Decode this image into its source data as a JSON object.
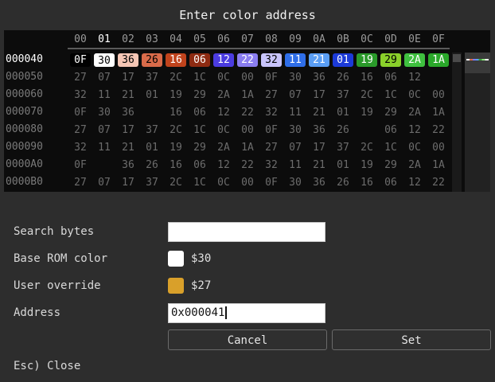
{
  "dialog": {
    "title": "Enter color address"
  },
  "hex": {
    "columns": [
      "00",
      "01",
      "02",
      "03",
      "04",
      "05",
      "06",
      "07",
      "08",
      "09",
      "0A",
      "0B",
      "0C",
      "0D",
      "0E",
      "0F"
    ],
    "selected_column": 1,
    "rows": [
      {
        "addr": "000040",
        "active": true,
        "bytes": [
          "0F",
          "30",
          "36",
          "26",
          "16",
          "06",
          "12",
          "22",
          "32",
          "11",
          "21",
          "01",
          "19",
          "29",
          "2A",
          "1A"
        ]
      },
      {
        "addr": "000050",
        "bytes": [
          "27",
          "07",
          "17",
          "37",
          "2C",
          "1C",
          "0C",
          "00",
          "0F",
          "30",
          "36",
          "26",
          "16",
          "06",
          "12",
          ""
        ]
      },
      {
        "addr": "000060",
        "bytes": [
          "32",
          "11",
          "21",
          "01",
          "19",
          "29",
          "2A",
          "1A",
          "27",
          "07",
          "17",
          "37",
          "2C",
          "1C",
          "0C",
          "00"
        ]
      },
      {
        "addr": "000070",
        "bytes": [
          "0F",
          "30",
          "36",
          "",
          "16",
          "06",
          "12",
          "22",
          "32",
          "11",
          "21",
          "01",
          "19",
          "29",
          "2A",
          "1A"
        ]
      },
      {
        "addr": "000080",
        "bytes": [
          "27",
          "07",
          "17",
          "37",
          "2C",
          "1C",
          "0C",
          "00",
          "0F",
          "30",
          "36",
          "26",
          "",
          "06",
          "12",
          "22"
        ]
      },
      {
        "addr": "000090",
        "bytes": [
          "32",
          "11",
          "21",
          "01",
          "19",
          "29",
          "2A",
          "1A",
          "27",
          "07",
          "17",
          "37",
          "2C",
          "1C",
          "0C",
          "00"
        ]
      },
      {
        "addr": "0000A0",
        "bytes": [
          "0F",
          "",
          "36",
          "26",
          "16",
          "06",
          "12",
          "22",
          "32",
          "11",
          "21",
          "01",
          "19",
          "29",
          "2A",
          "1A"
        ]
      },
      {
        "addr": "0000B0",
        "bytes": [
          "27",
          "07",
          "17",
          "37",
          "2C",
          "1C",
          "0C",
          "00",
          "0F",
          "30",
          "36",
          "26",
          "16",
          "06",
          "12",
          "22"
        ]
      }
    ],
    "active_colors": [
      "#000000",
      "#ffffff",
      "#f5c6b5",
      "#d96b4a",
      "#c0431c",
      "#8e2b12",
      "#4b3ce0",
      "#8a7df0",
      "#c8c4fb",
      "#2f6ee8",
      "#5a9ef5",
      "#1c3ad8",
      "#2a9a2a",
      "#8ad02a",
      "#3fc03f",
      "#2aa82a"
    ],
    "active_text_colors": [
      "#ffffff",
      "#000000",
      "#000000",
      "#000000",
      "#ffffff",
      "#ffffff",
      "#ffffff",
      "#ffffff",
      "#000000",
      "#ffffff",
      "#ffffff",
      "#ffffff",
      "#ffffff",
      "#000000",
      "#ffffff",
      "#ffffff"
    ]
  },
  "fields": {
    "search_label": "Search bytes",
    "search_value": "",
    "base_label": "Base ROM color",
    "base_value": "$30",
    "base_color": "#ffffff",
    "override_label": "User override",
    "override_value": "$27",
    "override_color": "#d9a02a",
    "address_label": "Address",
    "address_value": "0x000041"
  },
  "buttons": {
    "cancel": "Cancel",
    "set": "Set"
  },
  "footer": {
    "hint": "Esc) Close"
  }
}
